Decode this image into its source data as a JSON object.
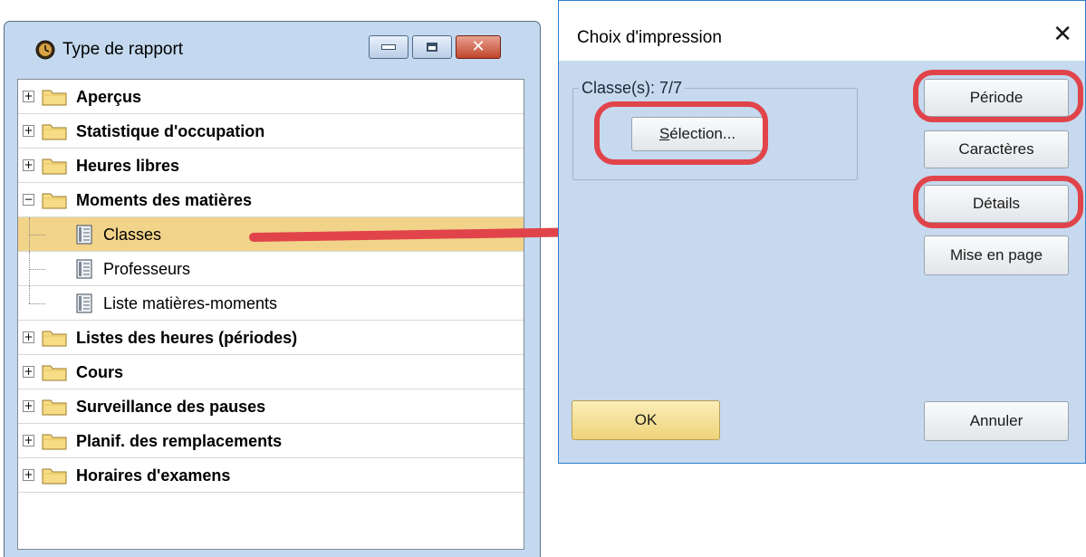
{
  "left_window": {
    "title": "Type de rapport",
    "controls": {
      "minimize": "minimize",
      "maximize": "maximize",
      "close": "✕"
    },
    "tree": [
      {
        "label": "Aperçus",
        "expander": "+",
        "type": "folder"
      },
      {
        "label": "Statistique d'occupation",
        "expander": "+",
        "type": "folder"
      },
      {
        "label": "Heures libres",
        "expander": "+",
        "type": "folder"
      },
      {
        "label": "Moments des matières",
        "expander": "−",
        "type": "folder"
      },
      {
        "label": "Classes",
        "type": "report",
        "selected": true
      },
      {
        "label": "Professeurs",
        "type": "report"
      },
      {
        "label": "Liste matières-moments",
        "type": "report"
      },
      {
        "label": "Listes des heures (périodes)",
        "expander": "+",
        "type": "folder"
      },
      {
        "label": "Cours",
        "expander": "+",
        "type": "folder"
      },
      {
        "label": "Surveillance des pauses",
        "expander": "+",
        "type": "folder"
      },
      {
        "label": "Planif. des remplacements",
        "expander": "+",
        "type": "folder"
      },
      {
        "label": "Horaires d'examens",
        "expander": "+",
        "type": "folder"
      }
    ]
  },
  "dialog": {
    "title": "Choix d'impression",
    "close_glyph": "✕",
    "group_label": "Classe(s): 7/7",
    "selection_button": {
      "first": "S",
      "rest": "élection..."
    },
    "buttons": {
      "periode": "Période",
      "caracteres": "Caractères",
      "details": "Détails",
      "mise_en_page": "Mise en page",
      "ok": "OK",
      "annuler": "Annuler"
    }
  },
  "colors": {
    "highlight_ring": "#e0444a",
    "window_frame": "#c4d9ef",
    "dialog_background": "#c6d9ee",
    "selected_row": "#f2d38a"
  }
}
